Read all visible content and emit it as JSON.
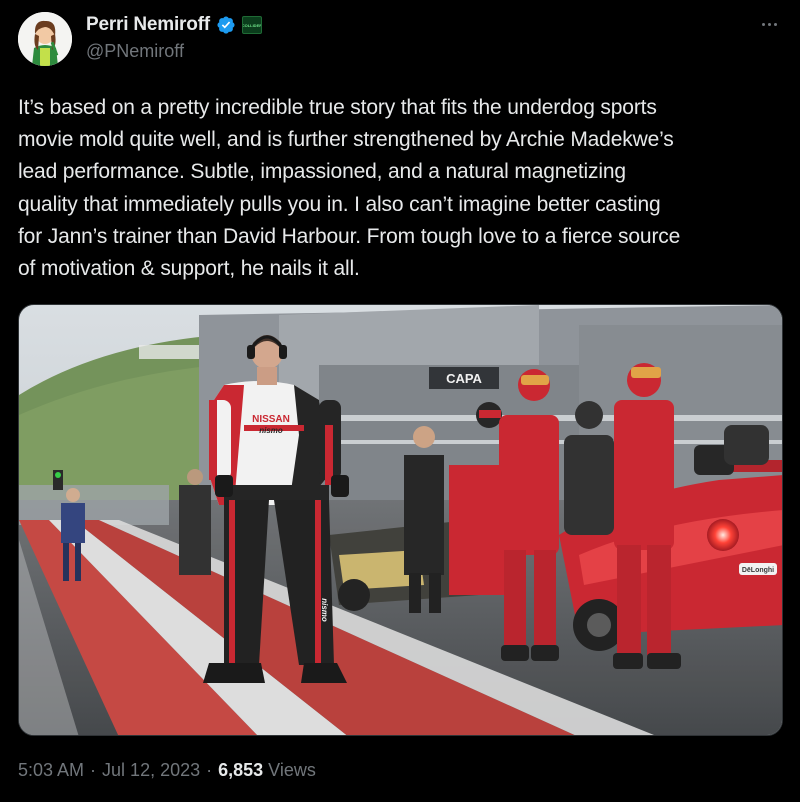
{
  "author": {
    "display_name": "Perri Nemiroff",
    "handle": "@PNemiroff",
    "verified_icon": "verified-badge-icon",
    "affiliate_badge": "COLLIDER",
    "avatar_icon": "avatar-illustration"
  },
  "more_icon": "more-options-icon",
  "tweet": {
    "text": "It’s based on a pretty incredible true story that fits the underdog sports\nmovie mold quite well, and is further strengthened by Archie Madekwe’s\nlead performance. Subtle, impassioned, and a natural magnetizing\nquality that immediately pulls you in. I also can’t imagine better casting\nfor Jann’s trainer than David Harbour. From tough love to a fierce source\nof motivation & support, he nails it all."
  },
  "media": {
    "jersey_brand": "NISSAN",
    "jersey_sub": "nismo",
    "leg_text": "nismo",
    "banner_text": "CAPA",
    "car_badge": "DēLonghi"
  },
  "footer": {
    "time": "5:03 AM",
    "separator": "·",
    "date": "Jul 12, 2023",
    "views_count": "6,853",
    "views_label": "Views"
  },
  "colors": {
    "background": "#000000",
    "text_primary": "#e7e9ea",
    "text_secondary": "#71767b",
    "verified_blue": "#1d9bf0",
    "suit_red": "#c8202a"
  }
}
